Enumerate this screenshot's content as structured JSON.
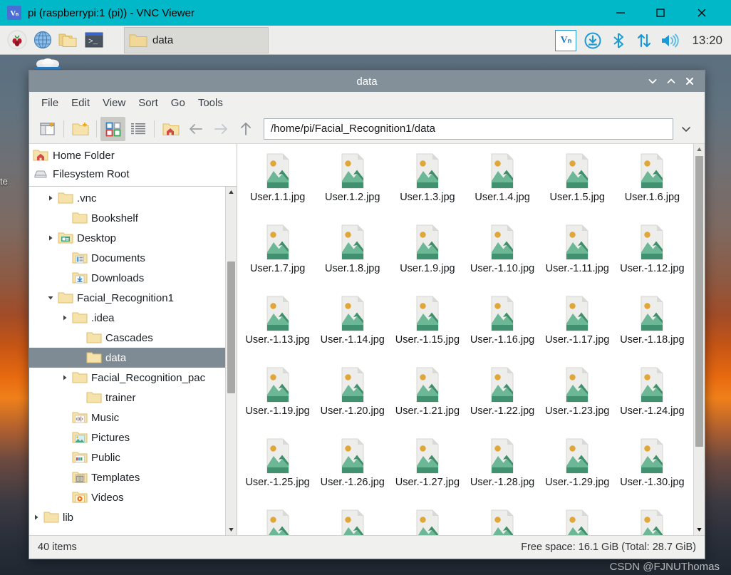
{
  "vnc": {
    "title": "pi (raspberrypi:1 (pi)) - VNC Viewer",
    "logo_text": "Vₙ",
    "minimize": "—",
    "maximize": "□",
    "close": "✕"
  },
  "taskbar": {
    "icons": [
      "raspberry-menu-icon",
      "web-browser-icon",
      "file-manager-icon",
      "terminal-icon"
    ],
    "task_button_label": "data",
    "tray": {
      "vnc_label": "Vₙ",
      "icons": [
        "update-icon",
        "bluetooth-icon",
        "network-icon",
        "volume-icon"
      ],
      "clock": "13:20"
    }
  },
  "desktop": {
    "icon_label": "te",
    "watermark": "CSDN @FJNUThomas"
  },
  "filemanager": {
    "title": "data",
    "window_controls": {
      "minimize": "⌄",
      "maximize": "⌃",
      "close": "✕"
    },
    "menu": [
      "File",
      "Edit",
      "View",
      "Sort",
      "Go",
      "Tools"
    ],
    "toolbar": {
      "new_tab": "new-tab-icon",
      "new_folder": "new-folder-icon",
      "icon_view": "icon-view-icon",
      "list_view": "list-view-icon",
      "home": "home-folder-icon",
      "back": "back-arrow-icon",
      "forward": "forward-arrow-icon",
      "up": "up-arrow-icon",
      "dropdown": "chevron-down-icon"
    },
    "path": "/home/pi/Facial_Recognition1/data",
    "places": [
      {
        "label": "Home Folder",
        "icon": "home-folder-icon"
      },
      {
        "label": "Filesystem Root",
        "icon": "drive-icon"
      }
    ],
    "tree": [
      {
        "label": ".vnc",
        "indent": 2,
        "twisty": "collapsed",
        "icon": "folder",
        "selected": false
      },
      {
        "label": "Bookshelf",
        "indent": 3,
        "twisty": "none",
        "icon": "folder",
        "selected": false
      },
      {
        "label": "Desktop",
        "indent": 2,
        "twisty": "collapsed",
        "icon": "desktop",
        "selected": false
      },
      {
        "label": "Documents",
        "indent": 3,
        "twisty": "none",
        "icon": "documents",
        "selected": false
      },
      {
        "label": "Downloads",
        "indent": 3,
        "twisty": "none",
        "icon": "downloads",
        "selected": false
      },
      {
        "label": "Facial_Recognition1",
        "indent": 2,
        "twisty": "expanded",
        "icon": "folder",
        "selected": false
      },
      {
        "label": ".idea",
        "indent": 3,
        "twisty": "collapsed",
        "icon": "folder",
        "selected": false
      },
      {
        "label": "Cascades",
        "indent": 4,
        "twisty": "none",
        "icon": "folder",
        "selected": false
      },
      {
        "label": "data",
        "indent": 4,
        "twisty": "none",
        "icon": "folder",
        "selected": true
      },
      {
        "label": "Facial_Recognition_pac",
        "indent": 3,
        "twisty": "collapsed",
        "icon": "folder",
        "selected": false
      },
      {
        "label": "trainer",
        "indent": 4,
        "twisty": "none",
        "icon": "folder",
        "selected": false
      },
      {
        "label": "Music",
        "indent": 3,
        "twisty": "none",
        "icon": "music",
        "selected": false
      },
      {
        "label": "Pictures",
        "indent": 3,
        "twisty": "none",
        "icon": "pictures",
        "selected": false
      },
      {
        "label": "Public",
        "indent": 3,
        "twisty": "none",
        "icon": "public",
        "selected": false
      },
      {
        "label": "Templates",
        "indent": 3,
        "twisty": "none",
        "icon": "templates",
        "selected": false
      },
      {
        "label": "Videos",
        "indent": 3,
        "twisty": "none",
        "icon": "videos",
        "selected": false
      },
      {
        "label": "lib",
        "indent": 1,
        "twisty": "collapsed",
        "icon": "folder",
        "selected": false
      }
    ],
    "files": [
      "User.1.1.jpg",
      "User.1.2.jpg",
      "User.1.3.jpg",
      "User.1.4.jpg",
      "User.1.5.jpg",
      "User.1.6.jpg",
      "User.1.7.jpg",
      "User.1.8.jpg",
      "User.1.9.jpg",
      "User.-1.10.jpg",
      "User.-1.11.jpg",
      "User.-1.12.jpg",
      "User.-1.13.jpg",
      "User.-1.14.jpg",
      "User.-1.15.jpg",
      "User.-1.16.jpg",
      "User.-1.17.jpg",
      "User.-1.18.jpg",
      "User.-1.19.jpg",
      "User.-1.20.jpg",
      "User.-1.21.jpg",
      "User.-1.22.jpg",
      "User.-1.23.jpg",
      "User.-1.24.jpg",
      "User.-1.25.jpg",
      "User.-1.26.jpg",
      "User.-1.27.jpg",
      "User.-1.28.jpg",
      "User.-1.29.jpg",
      "User.-1.30.jpg",
      "",
      "",
      "",
      "",
      "",
      ""
    ],
    "status": {
      "items": "40 items",
      "free_space": "Free space: 16.1 GiB (Total: 28.7 GiB)"
    }
  },
  "colors": {
    "vnc_cyan": "#00b8c8",
    "titlebar_gray": "#838f99",
    "selection_gray": "#7e8a94",
    "folder_yellow": "#f5d98a",
    "accent_blue": "#2298d4"
  }
}
